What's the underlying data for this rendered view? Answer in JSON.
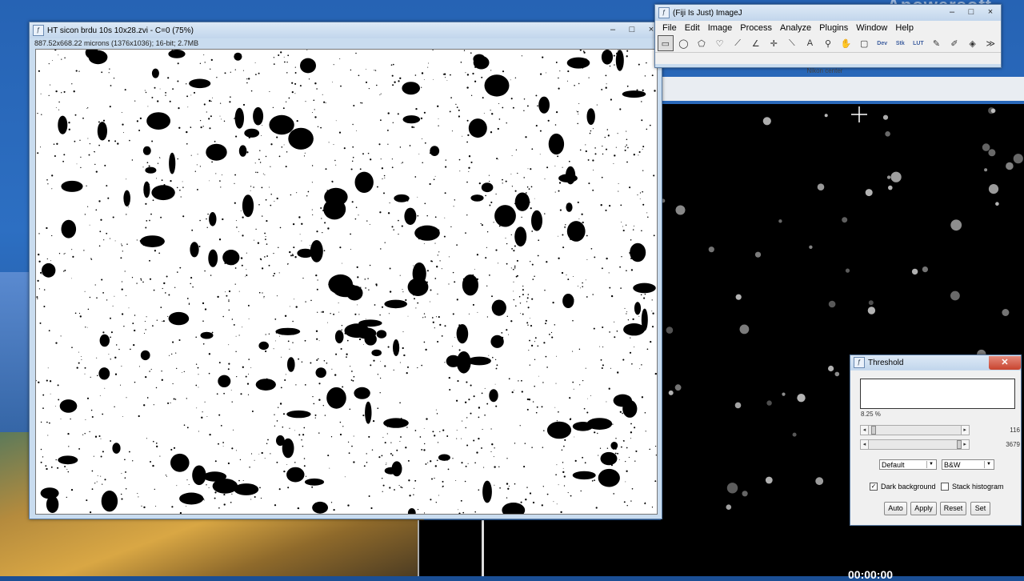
{
  "desktop": {
    "watermark": "Apowersoft"
  },
  "image_window": {
    "title": "HT sicon brdu 10s 10x28.zvi - C=0 (75%)",
    "info": "887.52x668.22 microns (1376x1036); 16-bit; 2.7MB",
    "minimize": "–",
    "maximize": "□",
    "close": "×"
  },
  "fiji": {
    "title": "(Fiji Is Just) ImageJ",
    "menus": [
      "File",
      "Edit",
      "Image",
      "Process",
      "Analyze",
      "Plugins",
      "Window",
      "Help"
    ],
    "tools": [
      {
        "name": "rectangle-tool-icon",
        "glyph": "▭"
      },
      {
        "name": "oval-tool-icon",
        "glyph": "◯"
      },
      {
        "name": "polygon-tool-icon",
        "glyph": "⬠"
      },
      {
        "name": "freehand-tool-icon",
        "glyph": "♡"
      },
      {
        "name": "line-tool-icon",
        "glyph": "⟋"
      },
      {
        "name": "angle-tool-icon",
        "glyph": "∠"
      },
      {
        "name": "point-tool-icon",
        "glyph": "✛"
      },
      {
        "name": "wand-tool-icon",
        "glyph": "⟍"
      },
      {
        "name": "text-tool-icon",
        "glyph": "A"
      },
      {
        "name": "magnifier-tool-icon",
        "glyph": "⚲"
      },
      {
        "name": "hand-tool-icon",
        "glyph": "✋"
      },
      {
        "name": "color-picker-tool-icon",
        "glyph": "▢"
      },
      {
        "name": "dev-tool-icon",
        "glyph": "Dev"
      },
      {
        "name": "stk-tool-icon",
        "glyph": "Stk"
      },
      {
        "name": "lut-tool-icon",
        "glyph": "LUT"
      },
      {
        "name": "pencil-tool-icon",
        "glyph": "✎"
      },
      {
        "name": "brush-tool-icon",
        "glyph": "✐"
      },
      {
        "name": "flood-fill-tool-icon",
        "glyph": "◈"
      },
      {
        "name": "more-tools-icon",
        "glyph": "≫"
      }
    ],
    "minimize": "–",
    "maximize": "□",
    "close": "×"
  },
  "dark_window": {
    "title": "Nikon center"
  },
  "threshold": {
    "title": "Threshold",
    "percent": "8.25 %",
    "lower_value": "116",
    "upper_value": "3679",
    "lower_fraction": 0.03,
    "upper_fraction": 1.0,
    "method": "Default",
    "mode": "B&W",
    "dark_background_label": "Dark background",
    "dark_background_checked": true,
    "stack_histogram_label": "Stack histogram",
    "stack_histogram_checked": false,
    "buttons": [
      "Auto",
      "Apply",
      "Reset",
      "Set"
    ],
    "close": "✕"
  },
  "clock": "00:00:00"
}
